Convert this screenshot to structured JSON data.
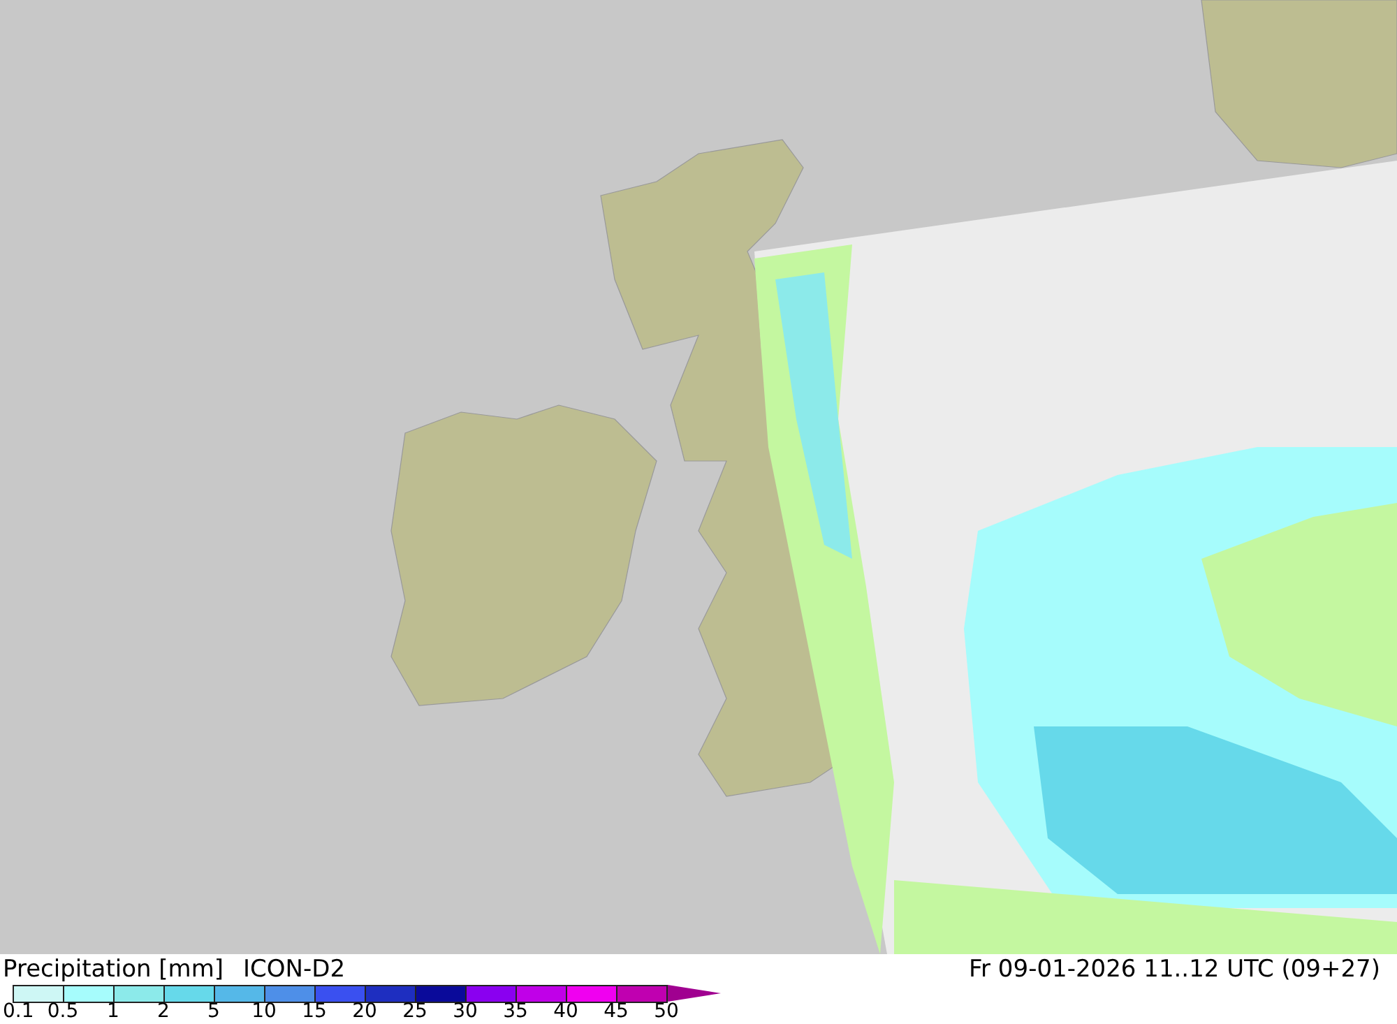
{
  "legend": {
    "title": "Precipitation [mm]",
    "model": "ICON-D2",
    "valid_time": "Fr 09-01-2026 11..12 UTC (09+27)",
    "scale": [
      {
        "color": "#cef7f5"
      },
      {
        "color": "#a6fcfc"
      },
      {
        "color": "#8ceaea"
      },
      {
        "color": "#66d9ea"
      },
      {
        "color": "#55b8e8"
      },
      {
        "color": "#4e8fe8"
      },
      {
        "color": "#3a50f0"
      },
      {
        "color": "#1e2ec0"
      },
      {
        "color": "#0a0a9a"
      },
      {
        "color": "#8a00f0"
      },
      {
        "color": "#c000e8"
      },
      {
        "color": "#f000f0"
      },
      {
        "color": "#c000b0"
      }
    ],
    "ticks": [
      "0.1",
      "0.5",
      "1",
      "2",
      "5",
      "10",
      "15",
      "20",
      "25",
      "30",
      "35",
      "40",
      "45",
      "50"
    ]
  }
}
